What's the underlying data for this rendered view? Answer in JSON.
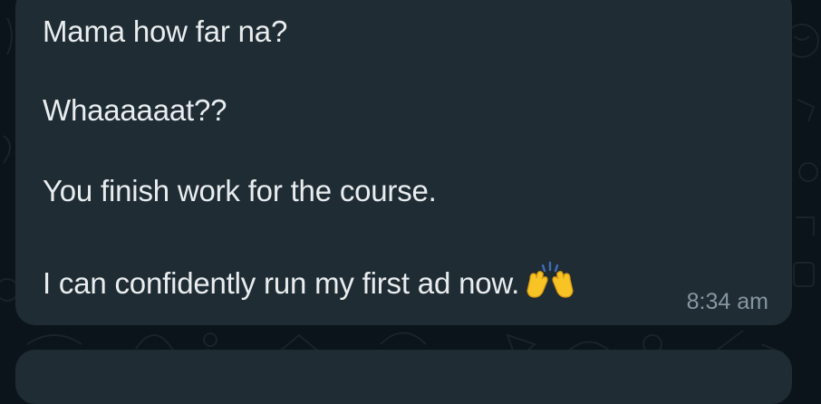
{
  "message": {
    "lines": [
      "Mama how far na?",
      "Whaaaaaat??",
      "You finish work for the course.",
      "I can confidently run my first ad now."
    ],
    "emoji": "raising-hands",
    "time": "8:34 am"
  },
  "colors": {
    "chat_background": "#0b141a",
    "bubble_background": "#1f2c34",
    "message_text": "#e9edef",
    "timestamp_text": "#8696a0",
    "emoji_yellow": "#f7c325"
  }
}
